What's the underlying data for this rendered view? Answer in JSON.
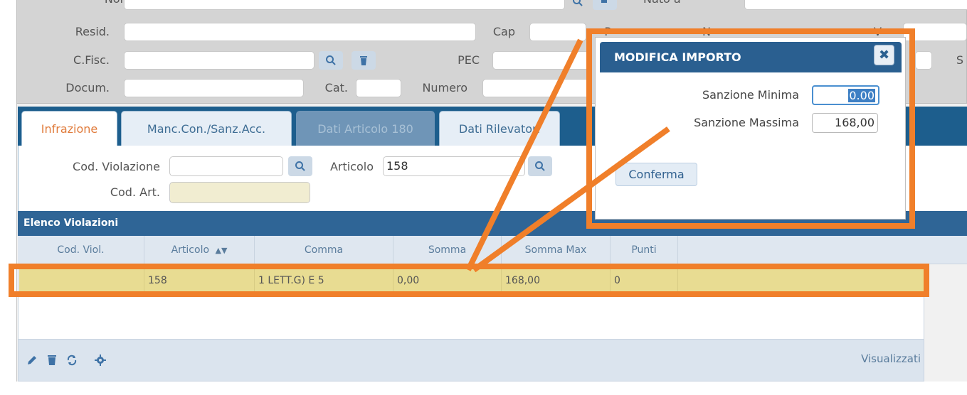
{
  "form": {
    "row0": {
      "label_left": "Nome",
      "label_right": "Nato a"
    },
    "row1": {
      "label_resid": "Resid.",
      "label_cap": "Cap",
      "label_prov": "P",
      "label_num": "N",
      "label_via": "V"
    },
    "row2": {
      "label_cfisc": "C.Fisc.",
      "label_pec": "PEC",
      "label_s": "S"
    },
    "row3": {
      "label_docum": "Docum.",
      "label_cat": "Cat.",
      "label_numero": "Numero"
    }
  },
  "tabs": [
    {
      "label": "Infrazione",
      "state": "active"
    },
    {
      "label": "Manc.Con./Sanz.Acc.",
      "state": "normal"
    },
    {
      "label": "Dati Articolo 180",
      "state": "disabled"
    },
    {
      "label": "Dati Rilevatori",
      "state": "normal"
    }
  ],
  "infrazione": {
    "cod_violazione_label": "Cod. Violazione",
    "cod_violazione_value": "",
    "articolo_label": "Articolo",
    "articolo_value": "158",
    "cod_art_label": "Cod. Art.",
    "cod_art_value": ""
  },
  "grid": {
    "title": "Elenco Violazioni",
    "columns": [
      "Cod. Viol.",
      "Articolo",
      "Comma",
      "Somma",
      "Somma Max",
      "Punti"
    ],
    "sort_icon": "sort-icon",
    "rows": [
      {
        "cod_viol": "",
        "articolo": "158",
        "comma": "1 LETT.G) E 5",
        "somma": "0,00",
        "somma_max": "168,00",
        "punti": "0"
      }
    ],
    "footer_status": "Visualizzati",
    "footer_icons": [
      "pencil-icon",
      "trash-icon",
      "refresh-icon",
      "gear-icon"
    ]
  },
  "dialog": {
    "title": "MODIFICA IMPORTO",
    "close_icon": "close-icon",
    "min_label": "Sanzione Minima",
    "min_value": "0.00",
    "max_label": "Sanzione Massima",
    "max_value": "168,00",
    "confirm_label": "Conferma"
  },
  "colors": {
    "highlight": "#f07f2a",
    "header_blue": "#2a5f90",
    "selected_row": "#e8dc92"
  }
}
